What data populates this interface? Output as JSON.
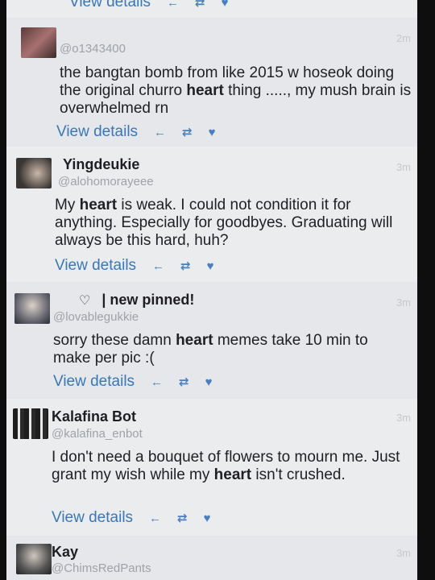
{
  "tweets": [
    {
      "name": "",
      "handle": "",
      "time": "",
      "body_parts": [],
      "view_label": "View details"
    },
    {
      "name": "",
      "handle": "@o1343400",
      "time": "2m",
      "body_parts": [
        {
          "t": "the bangtan bomb from like 2015 w hoseok doing the original churro ",
          "b": false
        },
        {
          "t": "heart",
          "b": true
        },
        {
          "t": " thing ....., my mush brain is overwhelmed rn",
          "b": false
        }
      ],
      "view_label": "View details"
    },
    {
      "name": "Yingdeukie",
      "handle": "@alohomorayeee",
      "time": "3m",
      "body_parts": [
        {
          "t": "My ",
          "b": false
        },
        {
          "t": "heart",
          "b": true
        },
        {
          "t": " is weak. I could not condition it for anything. Especially for goodbyes. Graduating will always be this hard, huh?",
          "b": false
        }
      ],
      "view_label": "View details"
    },
    {
      "name": "| new pinned!",
      "handle": "@lovablegukkie",
      "time": "3m",
      "body_parts": [
        {
          "t": "sorry these damn ",
          "b": false
        },
        {
          "t": "heart",
          "b": true
        },
        {
          "t": " memes take 10 min to make per pic :(",
          "b": false
        }
      ],
      "view_label": "View details"
    },
    {
      "name": "Kalafina Bot",
      "handle": "@kalafina_enbot",
      "time": "3m",
      "body_parts": [
        {
          "t": "I don't need a bouquet of flowers to mourn me. Just grant my wish while my ",
          "b": false
        },
        {
          "t": "heart",
          "b": true
        },
        {
          "t": " isn't crushed.",
          "b": false
        }
      ],
      "view_label": "View details"
    },
    {
      "name": "Kay",
      "handle": "@ChimsRedPants",
      "time": "3m",
      "body_parts": [],
      "view_label": ""
    }
  ],
  "icons": {
    "reply": "reply-icon",
    "retweet": "retweet-icon",
    "like": "heart-icon",
    "pinned_heart": "heart-outline-icon"
  },
  "colors": {
    "link": "#3877b8",
    "action": "#4a7fbf",
    "handle": "#9fa2a7",
    "background": "#e9eaec"
  }
}
